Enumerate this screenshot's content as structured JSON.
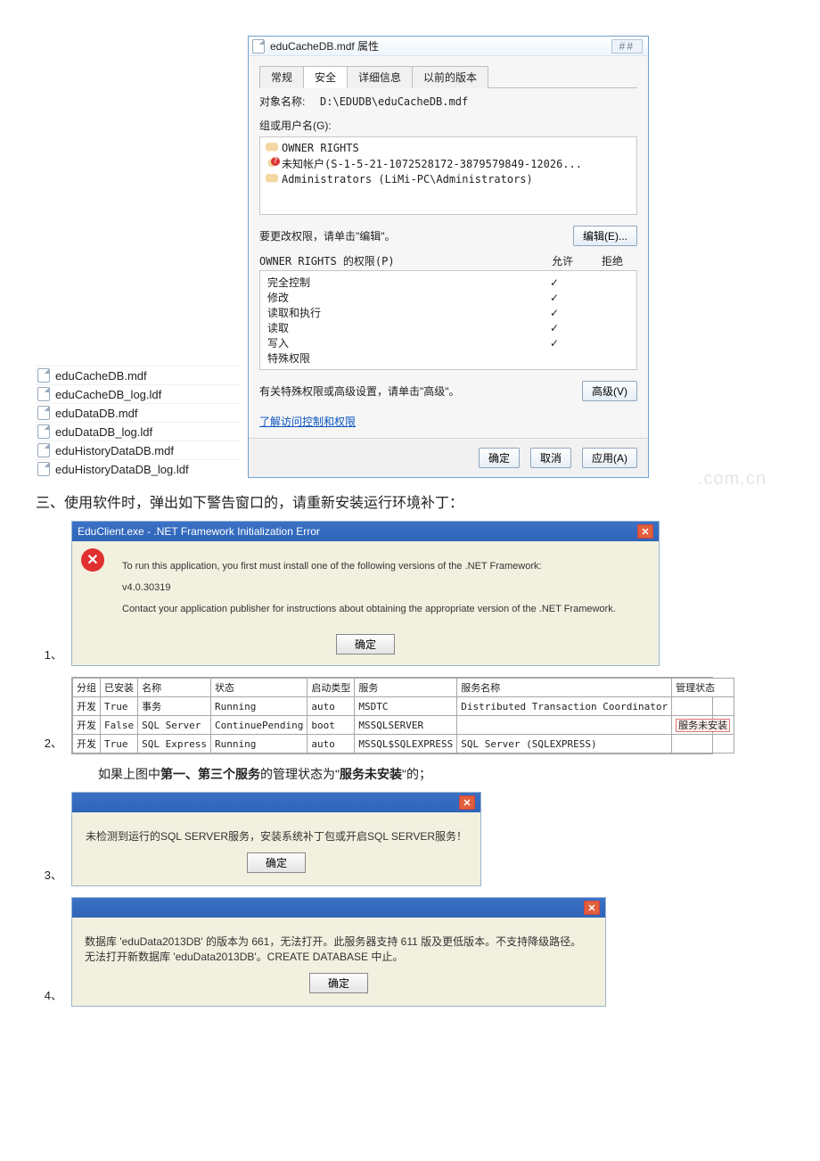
{
  "properties_dialog": {
    "title": "eduCacheDB.mdf 属性",
    "close_glyph": "▢",
    "tabs": {
      "general": "常规",
      "security": "安全",
      "details": "详细信息",
      "prev": "以前的版本"
    },
    "object_label": "对象名称:",
    "object_value": "D:\\EDUDB\\eduCacheDB.mdf",
    "group_label": "组或用户名(G):",
    "principals": {
      "owner": "OWNER RIGHTS",
      "unknown": "未知帐户(S-1-5-21-1072528172-3879579849-12026...",
      "admins": "Administrators (LiMi-PC\\Administrators)"
    },
    "edit_hint": "要更改权限，请单击\"编辑\"。",
    "edit_btn": "编辑(E)...",
    "perm_label": "OWNER RIGHTS 的权限(P)",
    "col_allow": "允许",
    "col_deny": "拒绝",
    "perms": [
      {
        "name": "完全控制",
        "allow": true
      },
      {
        "name": "修改",
        "allow": true
      },
      {
        "name": "读取和执行",
        "allow": true
      },
      {
        "name": "读取",
        "allow": true
      },
      {
        "name": "写入",
        "allow": true
      },
      {
        "name": "特殊权限",
        "allow": false
      }
    ],
    "adv_hint": "有关特殊权限或高级设置，请单击\"高级\"。",
    "adv_btn": "高级(V)",
    "link": "了解访问控制和权限",
    "ok": "确定",
    "cancel": "取消",
    "apply": "应用(A)"
  },
  "files": [
    "eduCacheDB.mdf",
    "eduCacheDB_log.ldf",
    "eduDataDB.mdf",
    "eduDataDB_log.ldf",
    "eduHistoryDataDB.mdf",
    "eduHistoryDataDB_log.ldf"
  ],
  "section3": "三、使用软件时，弹出如下警告窗口的，请重新安装运行环境补丁：",
  "watermark": ".com.cn",
  "err1": {
    "title": "EduClient.exe - .NET Framework Initialization Error",
    "line1": "To run this application, you first must install one of the following versions of the .NET Framework:",
    "line2": " v4.0.30319",
    "line3": "Contact your application publisher for instructions about obtaining the appropriate version of the .NET Framework.",
    "ok": "确定"
  },
  "svc": {
    "headers": [
      "分组",
      "已安装",
      "名称",
      "状态",
      "启动类型",
      "服务",
      "服务名称",
      "管理状态"
    ],
    "rows": [
      [
        "开发",
        "True",
        "事务",
        "Running",
        "auto",
        "MSDTC",
        "Distributed Transaction Coordinator",
        ""
      ],
      [
        "开发",
        "False",
        "SQL Server",
        "ContinuePending",
        "boot",
        "MSSQLSERVER",
        "",
        "服务未安装"
      ],
      [
        "开发",
        "True",
        "SQL Express",
        "Running",
        "auto",
        "MSSQL$SQLEXPRESS",
        "SQL Server (SQLEXPRESS)",
        ""
      ]
    ]
  },
  "desc2": {
    "a": "如果上图中",
    "b1": "第一、第三个服务",
    "c": "的管理状态为\"",
    "b2": "服务未安装",
    "d": "\"的；"
  },
  "err3": {
    "msg": "未检测到运行的SQL SERVER服务，安装系统补丁包或开启SQL SERVER服务！",
    "ok": "确定"
  },
  "err4": {
    "l1": "数据库 'eduData2013DB' 的版本为 661，无法打开。此服务器支持 611 版及更低版本。不支持降级路径。",
    "l2": "无法打开新数据库 'eduData2013DB'。CREATE DATABASE 中止。",
    "ok": "确定"
  },
  "nums": {
    "n1": "1、",
    "n2": "2、",
    "n3": "3、",
    "n4": "4、"
  }
}
